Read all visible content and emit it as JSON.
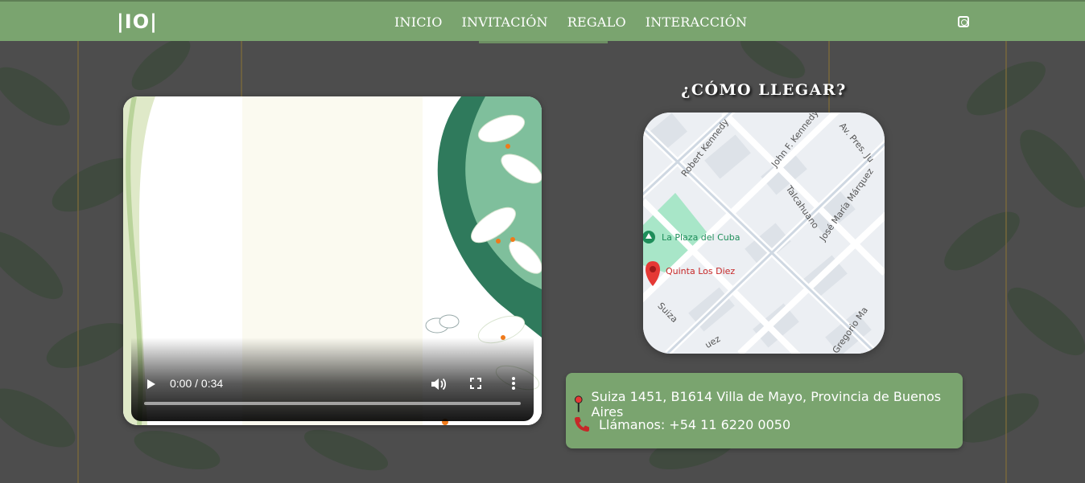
{
  "navbar": {
    "logo": "|IO|",
    "links": [
      {
        "label": "INICIO"
      },
      {
        "label": "INVITACIÓN"
      },
      {
        "label": "REGALO"
      },
      {
        "label": "INTERACCIÓN"
      }
    ],
    "social_icon": "instagram-icon"
  },
  "video": {
    "time": "0:00 / 0:34",
    "progress": 0
  },
  "location": {
    "title": "¿CÓMO LLEGAR?",
    "map": {
      "park_label": "La Plaza del Cuba",
      "place_label": "Quinta Los Diez",
      "streets": [
        "Robert Kennedy",
        "John F. Kennedy",
        "Av. Pres. Ju",
        "Talcahuano",
        "José María Márquez",
        "Suiza",
        "Gregorio Ma",
        "uez"
      ]
    },
    "address": "Suiza 1451, B1614 Villa de Mayo, Provincia de Buenos Aires",
    "phone": "Llámanos: +54 11 6220 0050"
  },
  "colors": {
    "accent_green": "#7aa46f",
    "background": "#4d4d4d",
    "pin_red": "#e53935"
  }
}
